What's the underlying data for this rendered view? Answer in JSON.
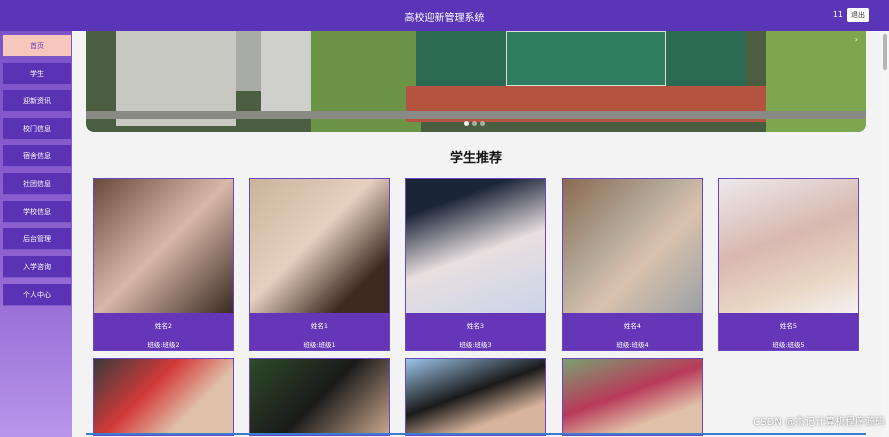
{
  "header": {
    "title": "高校迎新管理系统",
    "user": "11",
    "logout_label": "退出"
  },
  "sidebar": {
    "items": [
      {
        "label": "首页",
        "active": true
      },
      {
        "label": "学生"
      },
      {
        "label": "迎新资讯"
      },
      {
        "label": "校门信息"
      },
      {
        "label": "宿舍信息"
      },
      {
        "label": "社团信息"
      },
      {
        "label": "学校信息"
      },
      {
        "label": "后台管理"
      },
      {
        "label": "入学咨询"
      },
      {
        "label": "个人中心"
      }
    ]
  },
  "banner": {
    "next_icon": "chevron-right-icon",
    "dots": 3
  },
  "section": {
    "title": "学生推荐"
  },
  "cards": [
    {
      "name": "姓名2",
      "class": "班级:班级2"
    },
    {
      "name": "姓名1",
      "class": "班级:班级1"
    },
    {
      "name": "姓名3",
      "class": "班级:班级3"
    },
    {
      "name": "姓名4",
      "class": "班级:班级4"
    },
    {
      "name": "姓名5",
      "class": "班级:班级5"
    }
  ],
  "watermark": "CSDN @杰记计算机程序源码",
  "colors": {
    "primary": "#5b35b7",
    "active_bg": "#f5c8bb"
  }
}
